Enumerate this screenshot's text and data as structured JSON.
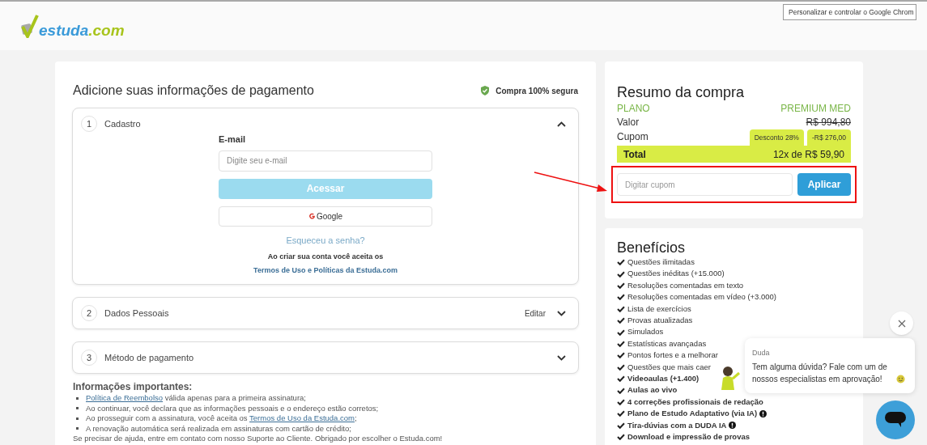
{
  "browser_tooltip": "Personalizar e controlar o Google Chrom",
  "logo": {
    "name": "estuda",
    "domain": ".com"
  },
  "payment": {
    "title": "Adicione suas informações de pagamento",
    "secure_badge": "Compra 100% segura",
    "steps": [
      {
        "number": "1",
        "title": "Cadastro",
        "expanded": true
      },
      {
        "number": "2",
        "title": "Dados Pessoais",
        "expanded": false,
        "action": "Editar"
      },
      {
        "number": "3",
        "title": "Método de pagamento",
        "expanded": false
      }
    ],
    "login": {
      "email_label": "E-mail",
      "email_placeholder": "Digite seu e-mail",
      "submit": "Acessar",
      "submit_disabled": true,
      "google": "Google",
      "forgot": "Esqueceu a senha?",
      "terms_note": "Ao criar sua conta você aceita os",
      "terms_link": "Termos de Uso e Políticas da Estuda.com"
    },
    "info": {
      "title": "Informações importantes:",
      "items": [
        {
          "link": "Política de Reembolso",
          "text": " válida apenas para a primeira assinatura;"
        },
        {
          "text": "Ao continuar, você declara que as informações pessoais e o endereço estão corretos;"
        },
        {
          "text": "Ao prosseguir com a assinatura, você aceita os ",
          "link": "Termos de Uso da Estuda.com",
          "after": ";"
        },
        {
          "text": "A renovação automática será realizada em assinaturas com cartão de crédito;"
        }
      ],
      "footer": "Se precisar de ajuda, entre em contato com nosso Suporte ao Cliente. Obrigado por escolher o Estuda.com!"
    }
  },
  "summary": {
    "title": "Resumo da compra",
    "plan_label": "PLANO",
    "plan_name": "PREMIUM MED",
    "value_label": "Valor",
    "value": "R$ 994,80",
    "coupon_label": "Cupom",
    "coupon_tags": [
      "Desconto 28%",
      "-R$ 276,00"
    ],
    "total_label": "Total",
    "total": "12x de R$ 59,90",
    "coupon_placeholder": "Digitar cupom",
    "apply": "Aplicar"
  },
  "benefits": {
    "title": "Benefícios",
    "items": [
      {
        "text": "Questões ilimitadas",
        "bold": false,
        "info": false
      },
      {
        "text": "Questões inéditas (+15.000)",
        "bold": false,
        "info": false
      },
      {
        "text": "Resoluções comentadas em texto",
        "bold": false,
        "info": false
      },
      {
        "text": "Resoluções comentadas em vídeo (+3.000)",
        "bold": false,
        "info": false
      },
      {
        "text": "Lista de exercícios",
        "bold": false,
        "info": false
      },
      {
        "text": "Provas atualizadas",
        "bold": false,
        "info": false
      },
      {
        "text": "Simulados",
        "bold": false,
        "info": false
      },
      {
        "text": "Estatísticas avançadas",
        "bold": false,
        "info": false
      },
      {
        "text": "Pontos fortes e a melhorar",
        "bold": false,
        "info": false
      },
      {
        "text": "Questões que mais caer",
        "bold": false,
        "info": false
      },
      {
        "text": "Videoaulas (+1.400)",
        "bold": true,
        "info": false
      },
      {
        "text": "Aulas ao vivo",
        "bold": true,
        "info": false
      },
      {
        "text": "4 correções profissionais de redação",
        "bold": true,
        "info": false
      },
      {
        "text": "Plano de Estudo Adaptativo (via IA)",
        "bold": true,
        "info": true
      },
      {
        "text": "Tira-dúvias com a DUDA IA",
        "bold": true,
        "info": true
      },
      {
        "text": "Download e impressão de provas",
        "bold": true,
        "info": false
      }
    ]
  },
  "chat": {
    "agent": "Duda",
    "message": "Tem alguma dúvida? Fale com um de nossos especialistas em aprovação!"
  }
}
